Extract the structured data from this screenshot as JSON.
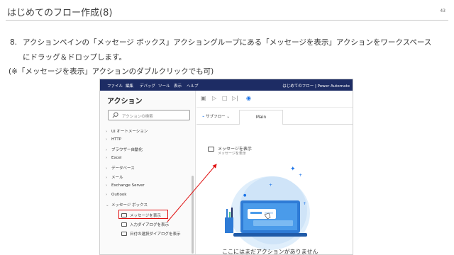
{
  "header": {
    "title": "はじめてのフロー作成(8)",
    "page_number": "43"
  },
  "step": {
    "number": "8.",
    "text": "アクションペインの「メッセージ ボックス」アクショングループにある「メッセージを表示」アクションをワークスペースにドラッグ＆ドロップします。"
  },
  "note": "(※「メッセージを表示」アクションのダブルクリックでも可)",
  "screenshot": {
    "menu": {
      "items": [
        "ファイル",
        "編集",
        "デバッグ",
        "ツール",
        "表示",
        "ヘルプ"
      ],
      "window_title": "はじめてのフロー | Power Automate"
    },
    "sidebar": {
      "title": "アクション",
      "search_placeholder": "アクションの検索",
      "groups": [
        "UI オートメーション",
        "HTTP",
        "ブラウザー自動化",
        "Excel",
        "データベース",
        "メール",
        "Exchange Server",
        "Outlook",
        "メッセージ ボックス"
      ],
      "children": [
        "メッセージを表示",
        "入力ダイアログを表示",
        "日付の選択ダイアログを表示"
      ]
    },
    "tabs": {
      "subflow": "サブフロー",
      "main": "Main"
    },
    "workspace": {
      "dropped_action": "メッセージを表示",
      "dropped_action_sub": "メッセージを表示",
      "empty_message": "ここにはまだアクションがありません"
    }
  },
  "colors": {
    "menubar": "#1d2c64",
    "highlight": "#e01010",
    "accent": "#1a73e8"
  }
}
